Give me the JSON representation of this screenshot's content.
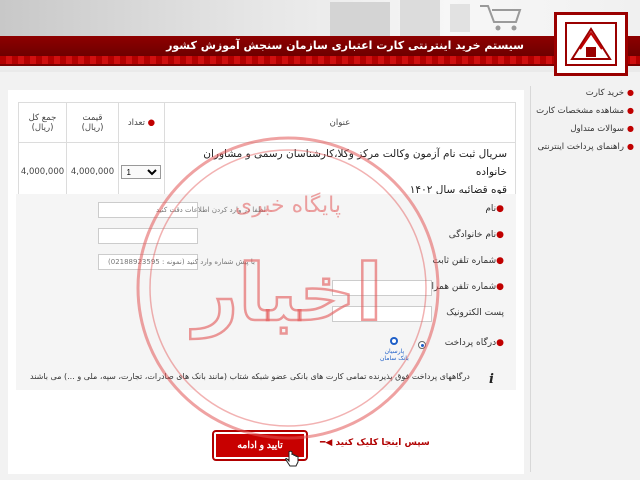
{
  "header": {
    "title": "سیستم خرید اینترنتی کارت اعتباری سازمان سنجش آموزش کشور"
  },
  "sidebar": {
    "items": [
      {
        "label": "خرید کارت"
      },
      {
        "label": "مشاهده مشخصات کارت"
      },
      {
        "label": "سوالات متداول"
      },
      {
        "label": "راهنمای پرداخت اینترنتی"
      }
    ]
  },
  "cart": {
    "headers": {
      "title": "عنوان",
      "quantity": "تعداد",
      "price_line1": "قیمت",
      "price_line2": "(ریال)",
      "total_line1": "جمع کل",
      "total_line2": "(ریال)"
    },
    "row": {
      "title_line1": "سریال ثبت نام آزمون وکالت مرکز وکلا،کارشناسان رسمی و مشاوران خانواده",
      "title_line2": "قوه قضائیه سال ۱۴۰۲",
      "quantity": "1",
      "price": "4,000,000",
      "total": "4,000,000"
    }
  },
  "form": {
    "first_name_label": "نام",
    "first_name_hint": "لطفا در وارد کردن اطلاعات دقت کنید",
    "last_name_label": "نام خانوادگی",
    "phone_label": "شماره تلفن ثابت",
    "phone_hint": "با پیش شماره وارد کنید (نمونه : 02188923595)",
    "mobile_label": "شماره تلفن همراه",
    "email_label": "پست الکترونیک",
    "gateway_label": "درگاه پرداخت",
    "gateway_name": "پارسیان\nبانک سامان"
  },
  "note": "درگاههای پرداخت فوق پذیرنده تمامی کارت های بانکی عضو شبکه شتاب (مانند بانک های صادرات، تجارت، سپه، ملی و ...) می باشند",
  "confirm_button": "تایید و ادامه",
  "annotation": "سپس اینجا کلیک کنید",
  "watermark": {
    "big": "اخبار",
    "small": "پایگاه خبری"
  },
  "colors": {
    "brand_red": "#9a0000",
    "button_red": "#c80000"
  }
}
